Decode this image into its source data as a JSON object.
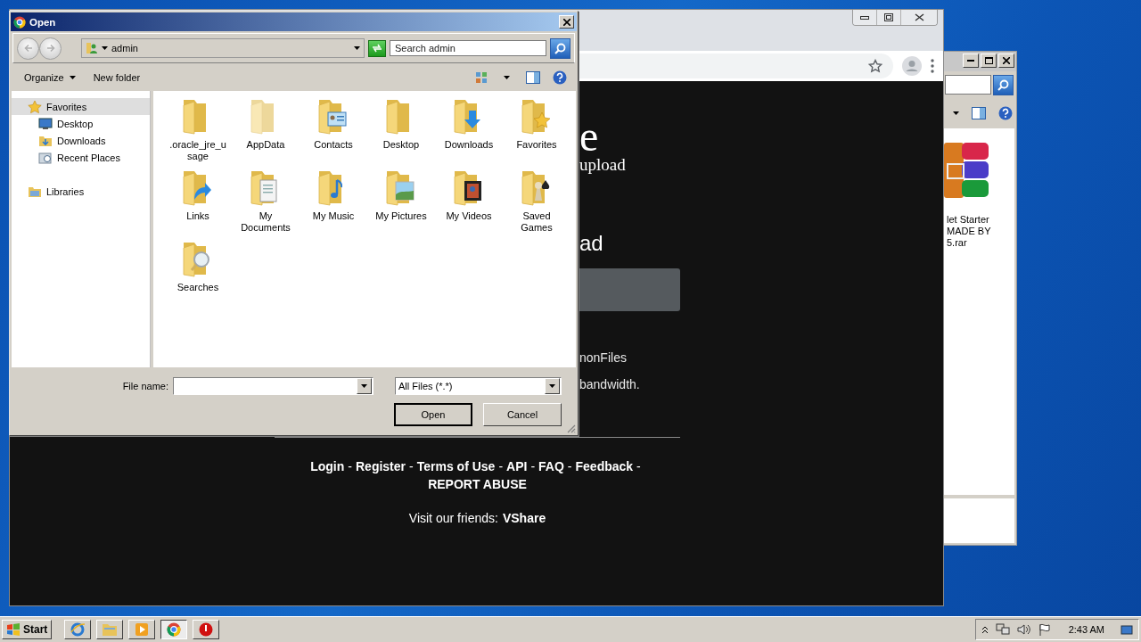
{
  "explorer_window": {
    "file_label_lines": [
      "let Starter",
      "MADE BY",
      "5.rar"
    ]
  },
  "browser": {
    "heading_fragment": "e",
    "subheading_fragment": "upload",
    "section_fragment": "ad",
    "lines": [
      "nonFiles",
      "bandwidth."
    ],
    "footer_items": [
      {
        "kind": "link",
        "text": "Login"
      },
      {
        "kind": "sep",
        "text": "-"
      },
      {
        "kind": "link",
        "text": "Register"
      },
      {
        "kind": "sep",
        "text": "-"
      },
      {
        "kind": "link",
        "text": "Terms of Use"
      },
      {
        "kind": "sep",
        "text": "-"
      },
      {
        "kind": "link",
        "text": "API"
      },
      {
        "kind": "sep",
        "text": "-"
      },
      {
        "kind": "link",
        "text": "FAQ"
      },
      {
        "kind": "sep",
        "text": "-"
      },
      {
        "kind": "link",
        "text": "Feedback"
      },
      {
        "kind": "sep",
        "text": "-"
      },
      {
        "kind": "link",
        "text": "REPORT ABUSE"
      }
    ],
    "friends_label": "Visit our friends:",
    "friends_link": "VShare"
  },
  "dialog": {
    "title": "Open",
    "location": "admin",
    "search": {
      "placeholder": "Search admin"
    },
    "toolbar": [
      "Organize",
      "New folder"
    ],
    "nav": [
      {
        "kind": "favorites",
        "label": "Favorites",
        "selected": true,
        "children": [
          {
            "kind": "desktop",
            "label": "Desktop",
            "selected": false
          },
          {
            "kind": "downloads",
            "label": "Downloads",
            "selected": false
          },
          {
            "kind": "recent",
            "label": "Recent Places",
            "selected": false
          }
        ]
      },
      {
        "kind": "libraries",
        "label": "Libraries",
        "selected": false
      }
    ],
    "folders": [
      {
        "kind": "plain",
        "name": ".oracle_jre_usage"
      },
      {
        "kind": "hidden",
        "name": "AppData"
      },
      {
        "kind": "contacts",
        "name": "Contacts"
      },
      {
        "kind": "plain",
        "name": "Desktop"
      },
      {
        "kind": "downloads",
        "name": "Downloads"
      },
      {
        "kind": "favorites",
        "name": "Favorites"
      },
      {
        "kind": "links",
        "name": "Links"
      },
      {
        "kind": "documents",
        "name": "My Documents"
      },
      {
        "kind": "music",
        "name": "My Music"
      },
      {
        "kind": "pictures",
        "name": "My Pictures"
      },
      {
        "kind": "videos",
        "name": "My Videos"
      },
      {
        "kind": "games",
        "name": "Saved Games"
      },
      {
        "kind": "searches",
        "name": "Searches"
      }
    ],
    "file_name_label": "File name:",
    "file_type": "All Files (*.*)",
    "buttons": [
      "Open",
      "Cancel"
    ]
  },
  "taskbar": {
    "start": "Start",
    "apps": [
      {
        "kind": "ie",
        "selected": false
      },
      {
        "kind": "explorer",
        "selected": false
      },
      {
        "kind": "media",
        "selected": false
      },
      {
        "kind": "chrome",
        "selected": true
      },
      {
        "kind": "stop",
        "selected": false
      }
    ],
    "clock": "2:43 AM"
  }
}
